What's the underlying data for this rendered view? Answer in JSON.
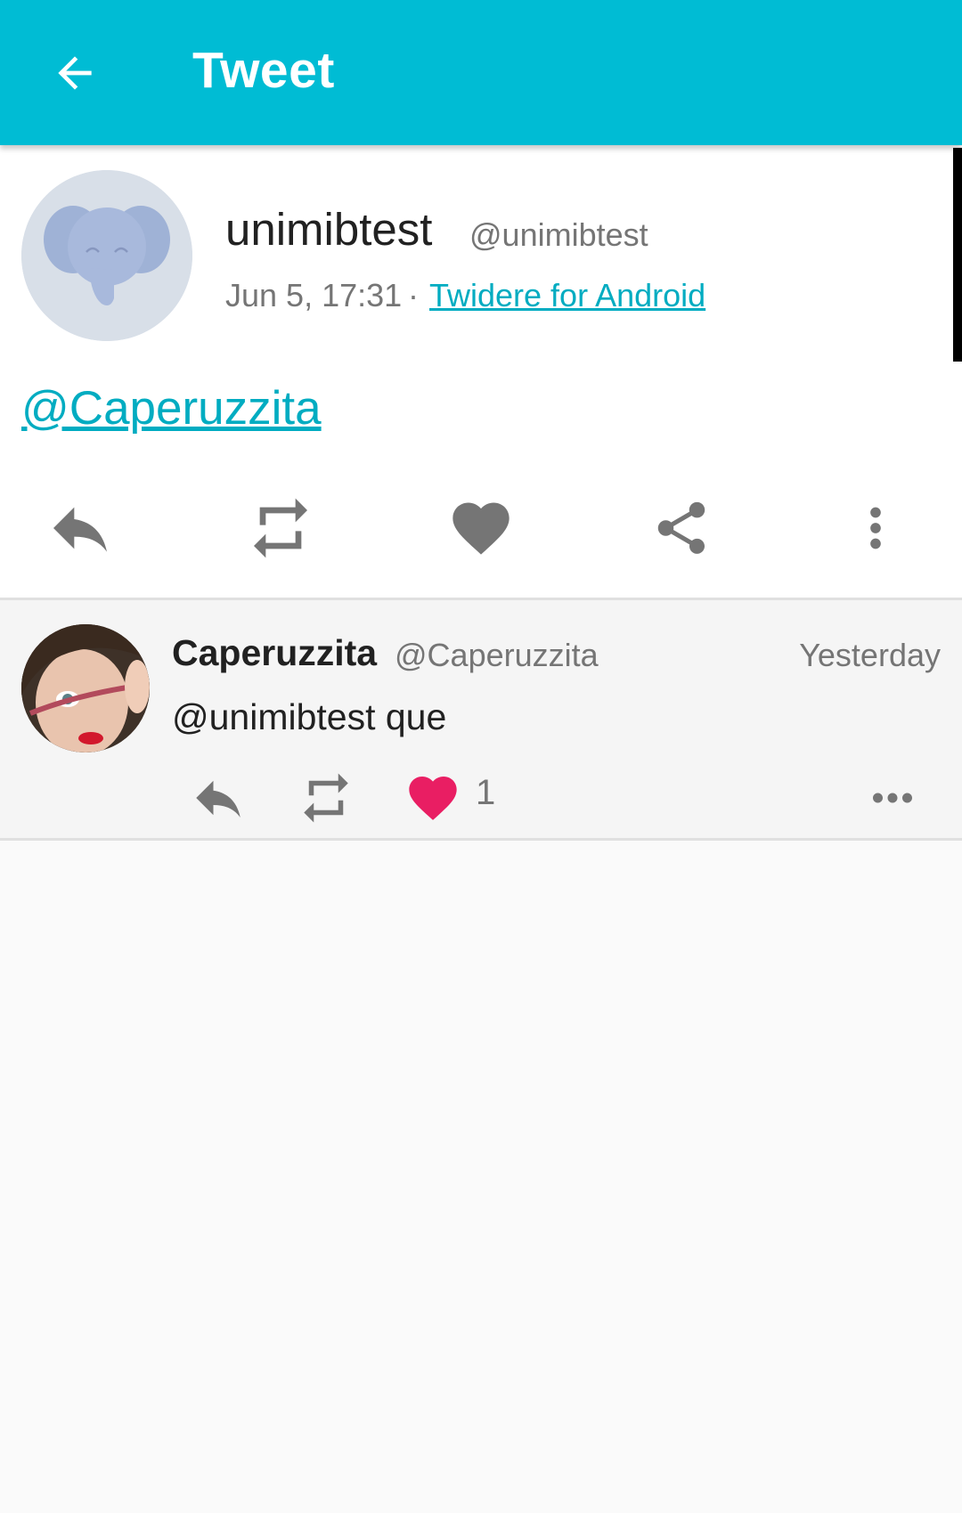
{
  "app_bar": {
    "title": "Tweet",
    "back_icon": "arrow-back-icon",
    "color": "#00bcd4"
  },
  "main_tweet": {
    "avatar_icon": "elephant-default-avatar-icon",
    "name": "unimibtest",
    "handle": "@unimibtest",
    "time": "Jun 5, 17:31",
    "separator": "·",
    "source": "Twidere for Android",
    "text": "@Caperuzzita",
    "actions": [
      "reply-icon",
      "retweet-icon",
      "like-icon",
      "share-icon",
      "more-vert-icon"
    ]
  },
  "reply": {
    "name": "Caperuzzita",
    "handle": "@Caperuzzita",
    "time": "Yesterday",
    "text": "@unimibtest que",
    "like_count": "1",
    "liked_color": "#e91e63",
    "actions": [
      "reply-icon",
      "retweet-icon",
      "like-icon",
      "more-horiz-icon"
    ]
  }
}
